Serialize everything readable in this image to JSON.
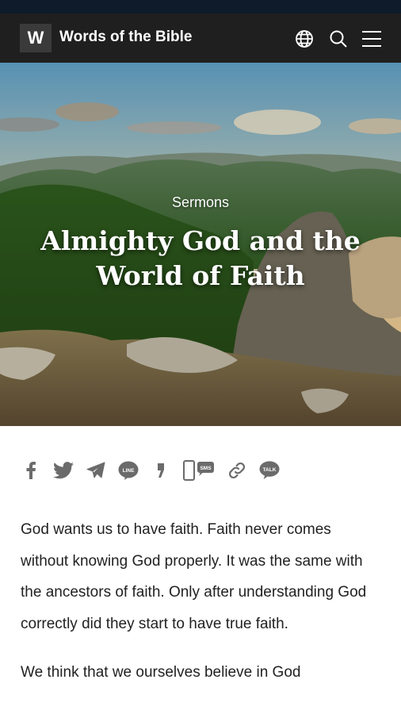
{
  "header": {
    "logo_letter": "W",
    "site_title": "Words of the Bible",
    "icons": [
      "globe-icon",
      "search-icon",
      "menu-icon"
    ]
  },
  "hero": {
    "category": "Sermons",
    "title": "Almighty God and the World of Faith"
  },
  "share": {
    "icons": [
      "facebook-icon",
      "twitter-icon",
      "telegram-icon",
      "line-icon",
      "kakaostory-icon",
      "sms-icon",
      "link-icon",
      "kakaotalk-icon"
    ],
    "line_label": "LINE",
    "sms_label": "SMS",
    "talk_label": "TALK"
  },
  "article": {
    "paragraphs": [
      "God wants us to have faith. Faith never comes without knowing God properly. It was the same with the ancestors of faith. Only after understanding God correctly did they start to have true faith.",
      "We think that we ourselves believe in God"
    ]
  },
  "colors": {
    "status_bar": "#0f1a2b",
    "header_bg": "#1f1f1f",
    "icon_gray": "#6b6b6b"
  }
}
